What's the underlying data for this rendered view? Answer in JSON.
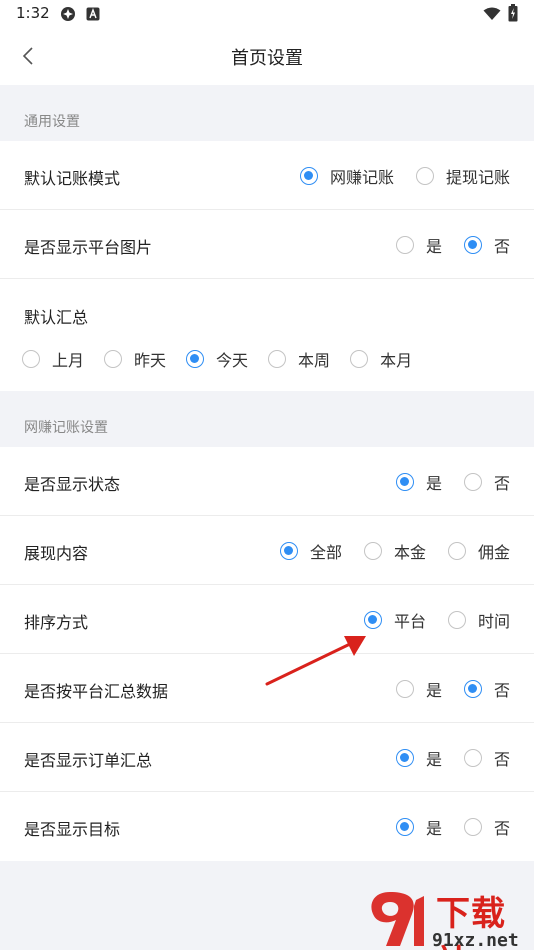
{
  "status_bar": {
    "time": "1:32"
  },
  "app_bar": {
    "title": "首页设置"
  },
  "sections": {
    "general": "通用设置",
    "online": "网赚记账设置"
  },
  "settings": {
    "default_mode": {
      "label": "默认记账模式",
      "options": [
        "网赚记账",
        "提现记账"
      ],
      "selected": 0
    },
    "show_platform_image": {
      "label": "是否显示平台图片",
      "options": [
        "是",
        "否"
      ],
      "selected": 1
    },
    "default_summary": {
      "label": "默认汇总",
      "options": [
        "上月",
        "昨天",
        "今天",
        "本周",
        "本月"
      ],
      "selected": 2
    },
    "show_status": {
      "label": "是否显示状态",
      "options": [
        "是",
        "否"
      ],
      "selected": 0
    },
    "display_content": {
      "label": "展现内容",
      "options": [
        "全部",
        "本金",
        "佣金"
      ],
      "selected": 0
    },
    "sort_method": {
      "label": "排序方式",
      "options": [
        "平台",
        "时间"
      ],
      "selected": 0
    },
    "summary_by_platform": {
      "label": "是否按平台汇总数据",
      "options": [
        "是",
        "否"
      ],
      "selected": 1
    },
    "show_order_summary": {
      "label": "是否显示订单汇总",
      "options": [
        "是",
        "否"
      ],
      "selected": 0
    },
    "show_goal": {
      "label": "是否显示目标",
      "options": [
        "是",
        "否"
      ],
      "selected": 0
    }
  },
  "watermark": {
    "text": "下载站",
    "domain": "91xz.net"
  },
  "colors": {
    "accent": "#2f8ef4",
    "background": "#f2f3f7",
    "arrow": "#d9221c"
  }
}
